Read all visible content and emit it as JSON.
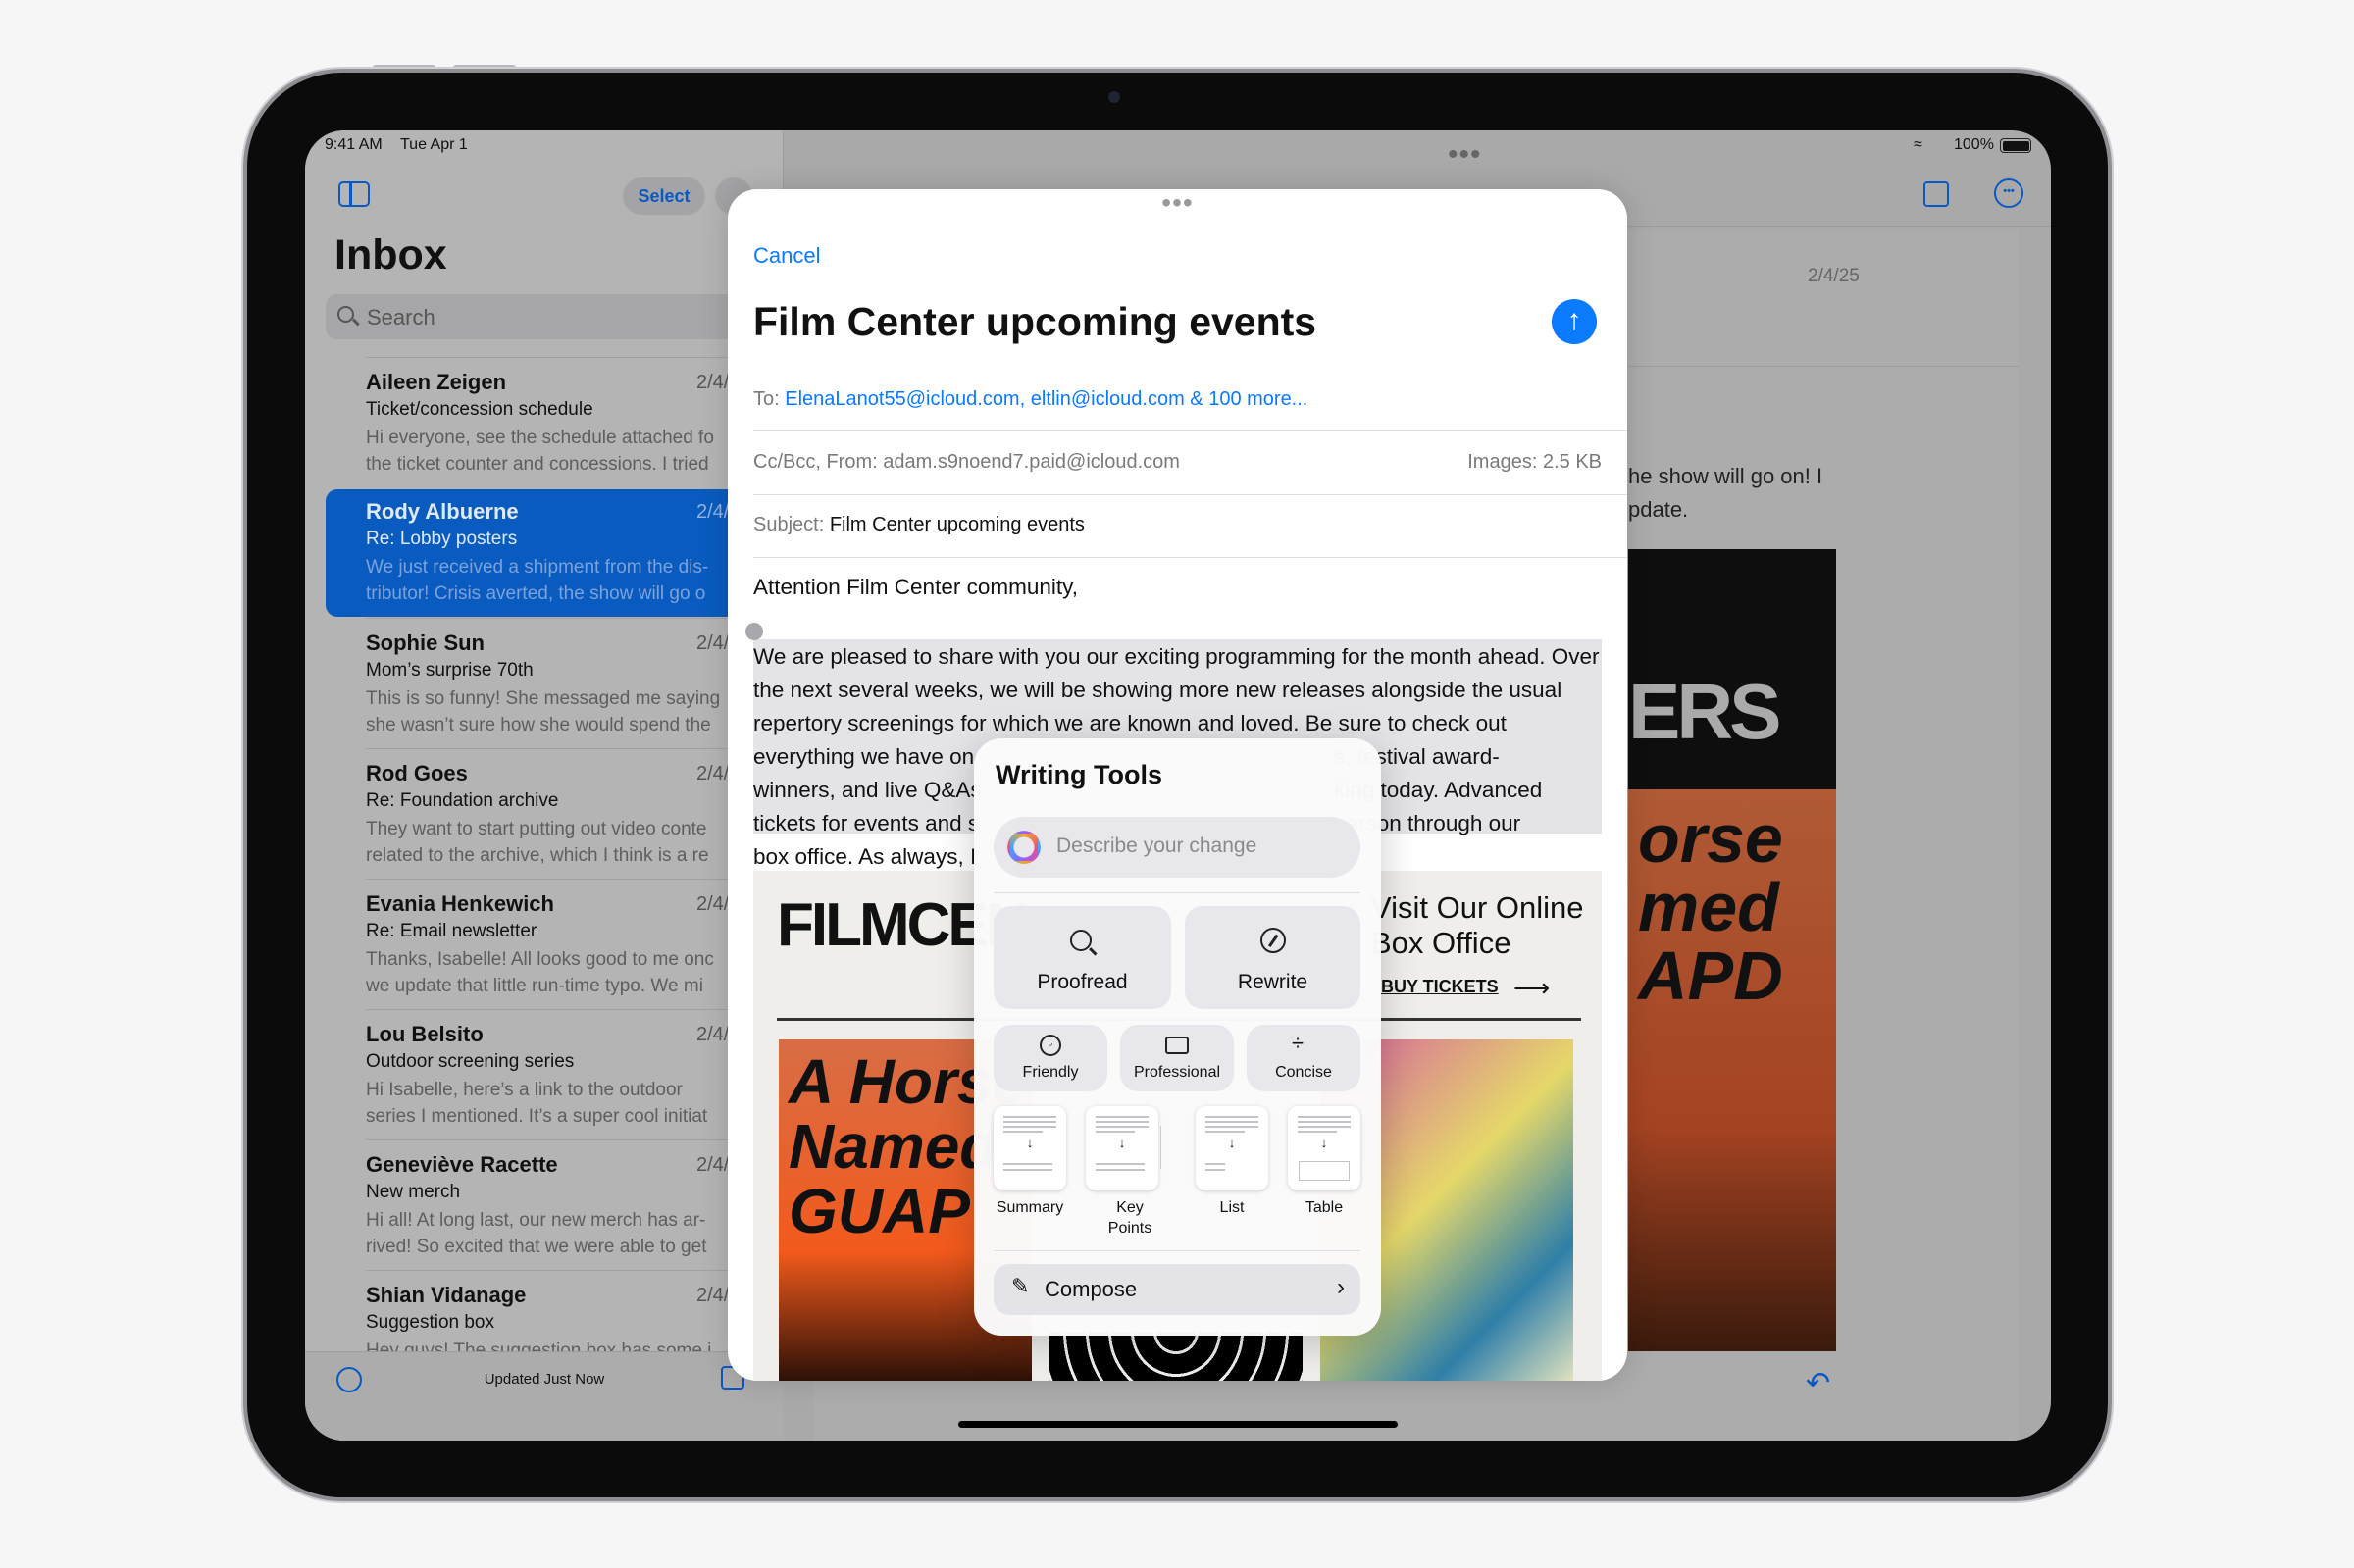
{
  "status_bar": {
    "time": "9:41 AM",
    "date": "Tue Apr 1",
    "battery": "100%"
  },
  "sidebar": {
    "select_label": "Select",
    "title": "Inbox",
    "search_placeholder": "Search",
    "items": [
      {
        "name": "Aileen Zeigen",
        "date": "2/4/",
        "subject": "Ticket/concession schedule",
        "preview": "Hi everyone, see the schedule attached fo\nthe ticket counter and concessions. I tried"
      },
      {
        "name": "Rody Albuerne",
        "date": "2/4/",
        "subject": "Re: Lobby posters",
        "preview": "We just received a shipment from the dis-\ntributor! Crisis averted, the show will go o",
        "selected": true
      },
      {
        "name": "Sophie Sun",
        "date": "2/4/",
        "subject": "Mom’s surprise 70th",
        "preview": "This is so funny! She messaged me saying\nshe wasn’t sure how she would spend the"
      },
      {
        "name": "Rod Goes",
        "date": "2/4/",
        "subject": "Re: Foundation archive",
        "preview": "They want to start putting out video conte\nrelated to the archive, which I think is a re"
      },
      {
        "name": "Evania Henkewich",
        "date": "2/4/",
        "subject": "Re: Email newsletter",
        "preview": "Thanks, Isabelle! All looks good to me onc\nwe update that little run-time typo. We mi"
      },
      {
        "name": "Lou Belsito",
        "date": "2/4/",
        "subject": "Outdoor screening series",
        "preview": "Hi Isabelle, here’s a link to the outdoor\nseries I mentioned. It’s a super cool initiat"
      },
      {
        "name": "Geneviève Racette",
        "date": "2/4/",
        "subject": "New merch",
        "preview": "Hi all! At long last, our new merch has ar-\nrived! So excited that we were able to get"
      },
      {
        "name": "Shian Vidanage",
        "date": "2/4/",
        "subject": "Suggestion box",
        "preview": "Hey guys! The suggestion box has some i"
      }
    ],
    "footer_status": "Updated Just Now"
  },
  "detail": {
    "date": "2/4/25",
    "body_line1": "he show will go on! I",
    "body_line2": "pdate.",
    "poster_text": "ERS",
    "poster_title": "orse\nmed\nAPD"
  },
  "compose": {
    "cancel_label": "Cancel",
    "title": "Film Center upcoming events",
    "to_label": "To:",
    "to_value": "ElenaLanot55@icloud.com, eltlin@icloud.com & 100 more...",
    "ccbcc_label": "Cc/Bcc, From:",
    "from_value": "adam.s9noend7.paid@icloud.com",
    "images_label": "Images:",
    "images_value": "2.5 KB",
    "subject_label": "Subject:",
    "subject_value": "Film Center upcoming events",
    "greeting": "Attention Film Center community,",
    "body_lines": [
      "We are pleased to share with you our exciting programming for the month ahead. Over",
      "the next several weeks, we will be showing more new releases alongside the usual",
      "repertory screenings for which we are known and loved. Be sure to check out",
      "everything we have on",
      "winners, and live Q&As",
      "tickets for events and s",
      "box office. As always, I"
    ],
    "body_lines_right": [
      "s, festival award-",
      "king today. Advanced",
      "person through our"
    ],
    "newsletter": {
      "logo": "FILMCENTER",
      "promo_title": "Visit Our Online Box Office",
      "promo_link": "BUY TICKETS",
      "poster_title": "A Horse Named GUAP"
    }
  },
  "writing_tools": {
    "title": "Writing Tools",
    "input_placeholder": "Describe your change",
    "primary": [
      {
        "label": "Proofread",
        "icon": "magnifier-text-icon"
      },
      {
        "label": "Rewrite",
        "icon": "rewrite-icon"
      }
    ],
    "tones": [
      {
        "label": "Friendly",
        "icon": "smiley-icon"
      },
      {
        "label": "Professional",
        "icon": "briefcase-icon"
      },
      {
        "label": "Concise",
        "icon": "compress-icon"
      }
    ],
    "formats": [
      {
        "label": "Summary"
      },
      {
        "label": "Key Points"
      },
      {
        "label": "List"
      },
      {
        "label": "Table"
      }
    ],
    "compose_label": "Compose"
  },
  "colors": {
    "accent": "#0a7aff",
    "selected_row": "#0a5bbf"
  }
}
